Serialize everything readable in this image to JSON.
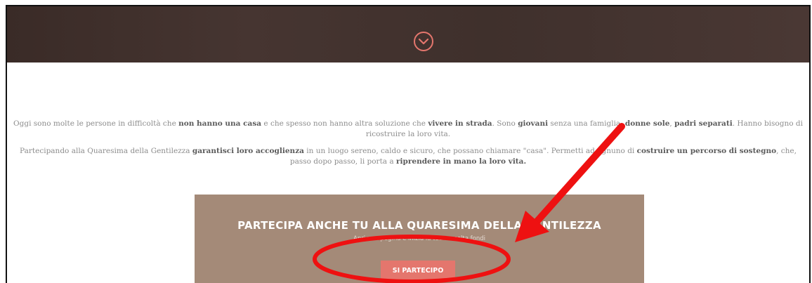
{
  "body": {
    "paragraph1": {
      "t1": "Oggi sono molte le persone in difficoltà che ",
      "b1": "non hanno una casa",
      "t2": " e che spesso non hanno altra soluzione che ",
      "b2": "vivere in strada",
      "t3": ". Sono ",
      "b3": "giovani",
      "t4": " senza una famiglia, ",
      "b4": "donne sole",
      "t5": ", ",
      "b5": "padri separati",
      "t6": ". Hanno bisogno di ricostruire la loro vita."
    },
    "paragraph2": {
      "t1": "Partecipando alla Quaresima della Gentilezza ",
      "b1": "garantisci loro accoglienza",
      "t2": " in un luogo sereno, caldo e sicuro, che possano chiamare \"casa\". Permetti ad ognuno di ",
      "b2": "costruire un percorso di sostegno",
      "t3": ", che, passo dopo passo, li porta a ",
      "b3": "riprendere in mano la loro vita."
    }
  },
  "cta": {
    "title": "PARTECIPA ANCHE TU ALLA QUARESIMA DELLA GENTILEZZA",
    "subtitle": "Apri una pagina e inizia la tua raccolta fondi",
    "button_label": "SI PARTECIPO"
  },
  "icons": {
    "chevron": "chevron-down-circle-icon",
    "annotation_arrow": "red-arrow-annotation",
    "annotation_ellipse": "red-ellipse-annotation"
  },
  "colors": {
    "topbar": "#3f302c",
    "chevron": "#e4766d",
    "cta_panel": "#a48a78",
    "cta_button": "#e4766d",
    "annotation": "#ee1111"
  }
}
